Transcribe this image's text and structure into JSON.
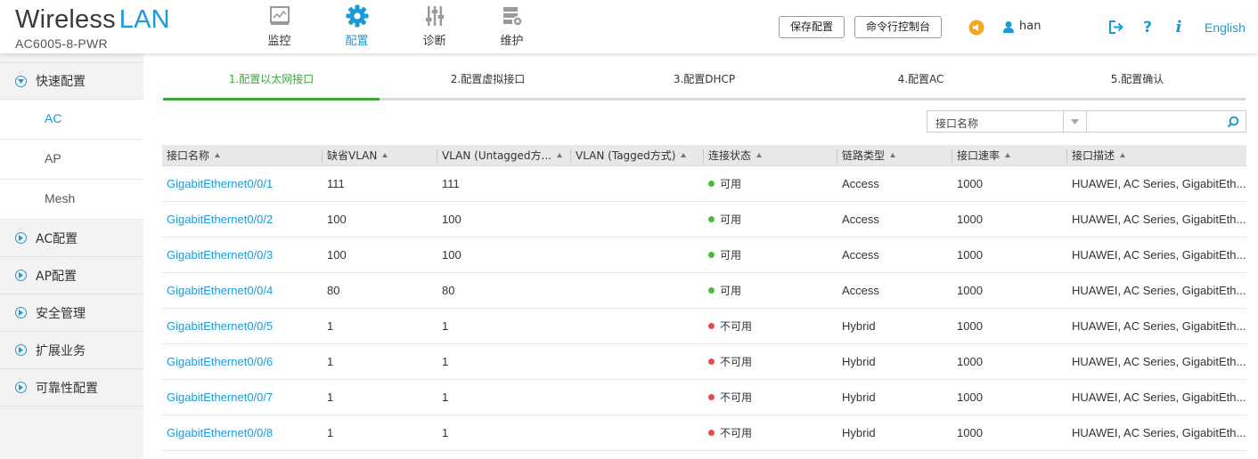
{
  "header": {
    "brand_main": "Wireless",
    "brand_accent": "LAN",
    "model": "AC6005-8-PWR",
    "nav": [
      {
        "label": "监控",
        "icon": "monitor-icon"
      },
      {
        "label": "配置",
        "icon": "gear-icon"
      },
      {
        "label": "诊断",
        "icon": "sliders-icon"
      },
      {
        "label": "维护",
        "icon": "maintenance-icon"
      }
    ],
    "save_config": "保存配置",
    "cli_console": "命令行控制台",
    "username": "han",
    "language": "English"
  },
  "sidebar": {
    "items": [
      {
        "label": "快速配置",
        "expanded": true
      },
      {
        "label": "AC",
        "sub": true,
        "active": true
      },
      {
        "label": "AP",
        "sub": true
      },
      {
        "label": "Mesh",
        "sub": true
      },
      {
        "label": "AC配置"
      },
      {
        "label": "AP配置"
      },
      {
        "label": "安全管理"
      },
      {
        "label": "扩展业务"
      },
      {
        "label": "可靠性配置"
      }
    ]
  },
  "steps": [
    {
      "label": "1.配置以太网接口"
    },
    {
      "label": "2.配置虚拟接口"
    },
    {
      "label": "3.配置DHCP"
    },
    {
      "label": "4.配置AC"
    },
    {
      "label": "5.配置确认"
    }
  ],
  "filter": {
    "field": "接口名称",
    "query": ""
  },
  "table": {
    "columns": [
      "接口名称",
      "缺省VLAN",
      "VLAN (Untagged方...",
      "VLAN (Tagged方式)",
      "连接状态",
      "链路类型",
      "接口速率",
      "接口描述"
    ],
    "rows": [
      {
        "name": "GigabitEthernet0/0/1",
        "pvid": "111",
        "untagged": "111",
        "tagged": "",
        "status": "可用",
        "up": true,
        "link": "Access",
        "speed": "1000",
        "desc": "HUAWEI, AC Series, GigabitEth..."
      },
      {
        "name": "GigabitEthernet0/0/2",
        "pvid": "100",
        "untagged": "100",
        "tagged": "",
        "status": "可用",
        "up": true,
        "link": "Access",
        "speed": "1000",
        "desc": "HUAWEI, AC Series, GigabitEth..."
      },
      {
        "name": "GigabitEthernet0/0/3",
        "pvid": "100",
        "untagged": "100",
        "tagged": "",
        "status": "可用",
        "up": true,
        "link": "Access",
        "speed": "1000",
        "desc": "HUAWEI, AC Series, GigabitEth..."
      },
      {
        "name": "GigabitEthernet0/0/4",
        "pvid": "80",
        "untagged": "80",
        "tagged": "",
        "status": "可用",
        "up": true,
        "link": "Access",
        "speed": "1000",
        "desc": "HUAWEI, AC Series, GigabitEth..."
      },
      {
        "name": "GigabitEthernet0/0/5",
        "pvid": "1",
        "untagged": "1",
        "tagged": "",
        "status": "不可用",
        "up": false,
        "link": "Hybrid",
        "speed": "1000",
        "desc": "HUAWEI, AC Series, GigabitEth..."
      },
      {
        "name": "GigabitEthernet0/0/6",
        "pvid": "1",
        "untagged": "1",
        "tagged": "",
        "status": "不可用",
        "up": false,
        "link": "Hybrid",
        "speed": "1000",
        "desc": "HUAWEI, AC Series, GigabitEth..."
      },
      {
        "name": "GigabitEthernet0/0/7",
        "pvid": "1",
        "untagged": "1",
        "tagged": "",
        "status": "不可用",
        "up": false,
        "link": "Hybrid",
        "speed": "1000",
        "desc": "HUAWEI, AC Series, GigabitEth..."
      },
      {
        "name": "GigabitEthernet0/0/8",
        "pvid": "1",
        "untagged": "1",
        "tagged": "",
        "status": "不可用",
        "up": false,
        "link": "Hybrid",
        "speed": "1000",
        "desc": "HUAWEI, AC Series, GigabitEth..."
      }
    ]
  },
  "colors": {
    "accent": "#1a9bd7",
    "step_active": "#3aa63a",
    "status_up": "#4cbb3a",
    "status_down": "#e84a4a",
    "alert_icon": "#f5a623"
  }
}
